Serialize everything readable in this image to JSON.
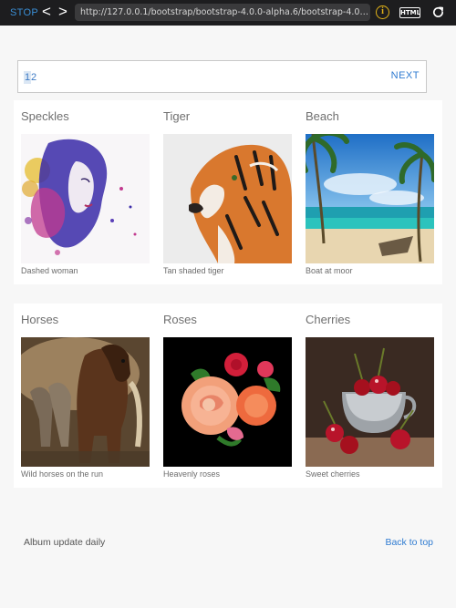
{
  "browser": {
    "stop_label": "STOP",
    "back_label": "<",
    "forward_label": ">",
    "url": "http://127.0.0.1/bootstrap/bootstrap-4.0.0-alpha.6/bootstrap-4.0.0-alpha....",
    "info_icon": "info-icon",
    "info_glyph": "i",
    "html_label": "HTML",
    "reload_icon": "reload-icon"
  },
  "pager": {
    "pages": [
      "1",
      "2"
    ],
    "current_page": "1",
    "next_label": "NEXT"
  },
  "gallery": {
    "rows": [
      {
        "items": [
          {
            "title": "Speckles",
            "caption": "Dashed woman",
            "image": "woman-splash-portrait"
          },
          {
            "title": "Tiger",
            "caption": "Tan shaded tiger",
            "image": "tiger-profile"
          },
          {
            "title": "Beach",
            "caption": "Boat at moor",
            "image": "tropical-beach-boat"
          }
        ]
      },
      {
        "items": [
          {
            "title": "Horses",
            "caption": "Wild horses on the run",
            "image": "running-horses"
          },
          {
            "title": "Roses",
            "caption": "Heavenly roses",
            "image": "pink-red-roses"
          },
          {
            "title": "Cherries",
            "caption": "Sweet cherries",
            "image": "cherries-silver-bowl"
          }
        ]
      }
    ]
  },
  "footer": {
    "note": "Album update daily",
    "back_to_top": "Back to top"
  },
  "colors": {
    "link": "#2f7bd1",
    "toolbar_bg": "#1d1d1f",
    "page_bg": "#f7f7f7"
  }
}
